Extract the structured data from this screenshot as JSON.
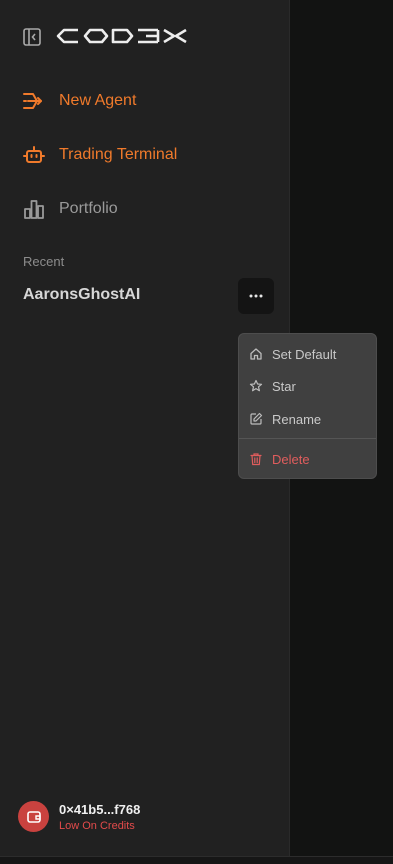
{
  "app": {
    "logo_text": "CODEX"
  },
  "nav": {
    "items": [
      {
        "label": "New Agent",
        "icon": "agent-arrows-icon",
        "color": "#f07a2b"
      },
      {
        "label": "Trading Terminal",
        "icon": "robot-icon",
        "color": "#f07a2b"
      },
      {
        "label": "Portfolio",
        "icon": "bar-chart-icon",
        "color": "#9a9a9a"
      }
    ]
  },
  "recent": {
    "title": "Recent",
    "items": [
      {
        "label": "AaronsGhostAI"
      }
    ],
    "more_label": "···"
  },
  "context_menu": {
    "items": [
      {
        "label": "Set Default",
        "icon": "home-icon"
      },
      {
        "label": "Star",
        "icon": "star-icon"
      },
      {
        "label": "Rename",
        "icon": "edit-icon"
      },
      {
        "label": "Delete",
        "icon": "trash-icon",
        "color": "#e05d5d"
      }
    ]
  },
  "wallet": {
    "address": "0×41b5...f768",
    "status": "Low On Credits",
    "status_color": "#e34b4b",
    "icon": "wallet-icon"
  },
  "colors": {
    "accent": "#f07a2b",
    "sidebar_bg": "#212121",
    "main_bg": "#121312",
    "danger": "#e05d5d"
  }
}
